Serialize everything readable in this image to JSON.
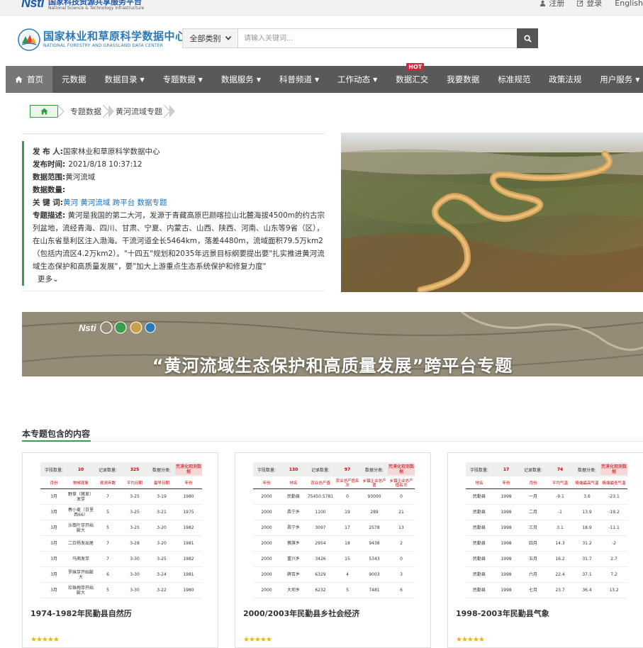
{
  "top": {
    "brand_abbr": "Nsti",
    "brand_cn": "国家科技资源共享服务平台",
    "brand_en": "National Science & Technology Infrastructure",
    "register": "注册",
    "login": "登录",
    "english": "English"
  },
  "header": {
    "name_cn": "国家林业和草原科学数据中心",
    "name_en": "NATIONAL FORESTRY AND GRASSLAND DATA CENTER"
  },
  "search": {
    "category": "全部类别",
    "placeholder": "请输入关键词..."
  },
  "nav": [
    {
      "label": "首页",
      "icon": "home-icon",
      "active": true
    },
    {
      "label": "元数据"
    },
    {
      "label": "数据目录",
      "dropdown": true
    },
    {
      "label": "专题数据",
      "dropdown": true
    },
    {
      "label": "数据服务",
      "dropdown": true
    },
    {
      "label": "科普频道",
      "dropdown": true
    },
    {
      "label": "工作动态",
      "dropdown": true
    },
    {
      "label": "数据汇交",
      "badge": "HOT"
    },
    {
      "label": "我要数据"
    },
    {
      "label": "标准规范"
    },
    {
      "label": "政策法规"
    },
    {
      "label": "用户服务",
      "dropdown": true
    }
  ],
  "breadcrumb": [
    "专题数据",
    "黄河流域专题"
  ],
  "info": {
    "publisher_label": "发 布 人:",
    "publisher": "国家林业和草原科学数据中心",
    "time_label": "发布时间:",
    "time": "2021/8/18 10:37:12",
    "range_label": "数据范围:",
    "range": "黄河流域",
    "count_label": "数据数量:",
    "count": "",
    "keywords_label": "关 键 词:",
    "keywords": "黄河 黄河流域 跨平台 数据专题",
    "desc_label": "专题描述:",
    "desc": "黄河是我国的第二大河，发源于青藏高原巴颜喀拉山北麓海拔4500m的约古宗列盆地，流经青海、四川、甘肃、宁夏、内蒙古、山西、陕西、河南、山东等9省（区），在山东省垦利区注入渤海。干流河道全长5464km，落差4480m，流域面积79.5万km2（包括内流区4.2万km2）。\"十四五\"规划和2035年远景目标纲要提出要\"扎实推进黄河流域生态保护和高质量发展\"，要\"加大上游重点生态系统保护和修复力度\"",
    "more": "更多"
  },
  "banner": {
    "title": "“黄河流域生态保护和高质量发展”跨平台专题",
    "logo_text": "Nsti"
  },
  "section": {
    "title": "本专题包含的内容"
  },
  "cards": [
    {
      "title": "1974-1982年民勤县自然历",
      "stat_fields": "字段数量:",
      "stat_fields_val": "10",
      "stat_records": "记录数量:",
      "stat_records_val": "325",
      "stat_cat": "数据分类:",
      "stat_tag": "荒漠化观测数据",
      "columns": [
        "月份",
        "物候现象",
        "观测年数",
        "平均日期",
        "最早日期",
        "年份"
      ],
      "rows": [
        [
          "3月",
          "野草（猪草）发芽",
          "7",
          "3-25",
          "3-19",
          "1980"
        ],
        [
          "3月",
          "春小麦（日里西66）",
          "5",
          "3-25",
          "3-21",
          "1975"
        ],
        [
          "3月",
          "沙蒿叶芽开始膨大",
          "5",
          "3-25",
          "3-20",
          "1982"
        ],
        [
          "3月",
          "二白杨发出尾",
          "7",
          "3-28",
          "3-20",
          "1981"
        ],
        [
          "3月",
          "马蔺发芽",
          "7",
          "3-30",
          "3-25",
          "1982"
        ],
        [
          "3月",
          "罗麻芽开始膨大",
          "6",
          "3-30",
          "3-24",
          "1981"
        ],
        [
          "3月",
          "珍珠梅芽开始膨大",
          "5",
          "3-30",
          "3-22",
          "1980"
        ]
      ]
    },
    {
      "title": "2000/2003年民勤县乡社会经济",
      "stat_fields": "字段数量:",
      "stat_fields_val": "130",
      "stat_records": "记录数量:",
      "stat_records_val": "97",
      "stat_cat": "数据分类:",
      "stat_tag": "荒漠化观测数据",
      "columns": [
        "年份",
        "地名",
        "农业总产值",
        "农业总产值名次",
        "乡镇企业总产值",
        "乡镇企业总产值名次"
      ],
      "rows": [
        [
          "2000",
          "民勤县",
          "75450.5781",
          "0",
          "93000",
          "0"
        ],
        [
          "2000",
          "昌宁乡",
          "1100",
          "19",
          "289",
          "21"
        ],
        [
          "2000",
          "昌宁乡",
          "3097",
          "17",
          "2578",
          "13"
        ],
        [
          "2000",
          "蔡旗乡",
          "2954",
          "18",
          "9438",
          "2"
        ],
        [
          "2000",
          "重兴乡",
          "3426",
          "15",
          "5343",
          "0"
        ],
        [
          "2000",
          "薛百乡",
          "6329",
          "4",
          "9003",
          "3"
        ],
        [
          "2000",
          "大坝乡",
          "6232",
          "5",
          "7481",
          "6"
        ]
      ]
    },
    {
      "title": "1998-2003年民勤县气象",
      "stat_fields": "字段数量:",
      "stat_fields_val": "17",
      "stat_records": "记录数量:",
      "stat_records_val": "74",
      "stat_cat": "数据分类:",
      "stat_tag": "荒漠化观测数据",
      "columns": [
        "地名",
        "年份",
        "月份",
        "平均气温",
        "极端最高气温",
        "极端最低气温"
      ],
      "rows": [
        [
          "民勤县",
          "1998",
          "一月",
          "-9.1",
          "3.6",
          "-23.1"
        ],
        [
          "民勤县",
          "1998",
          "二月",
          "-1",
          "13.9",
          "-19.2"
        ],
        [
          "民勤县",
          "1998",
          "三月",
          "3.1",
          "18.9",
          "-11.1"
        ],
        [
          "民勤县",
          "1998",
          "四月",
          "14.3",
          "31.2",
          "-2"
        ],
        [
          "民勤县",
          "1998",
          "五月",
          "16.2",
          "31.7",
          "2.7"
        ],
        [
          "民勤县",
          "1998",
          "六月",
          "22.4",
          "37.1",
          "7.2"
        ],
        [
          "民勤县",
          "1998",
          "七月",
          "23.7",
          "36.4",
          "13.2"
        ]
      ]
    }
  ],
  "colors": {
    "nav_bg": "#595959",
    "accent": "#3e9c52",
    "link": "#1b6fb8",
    "hot": "#d6243b"
  }
}
